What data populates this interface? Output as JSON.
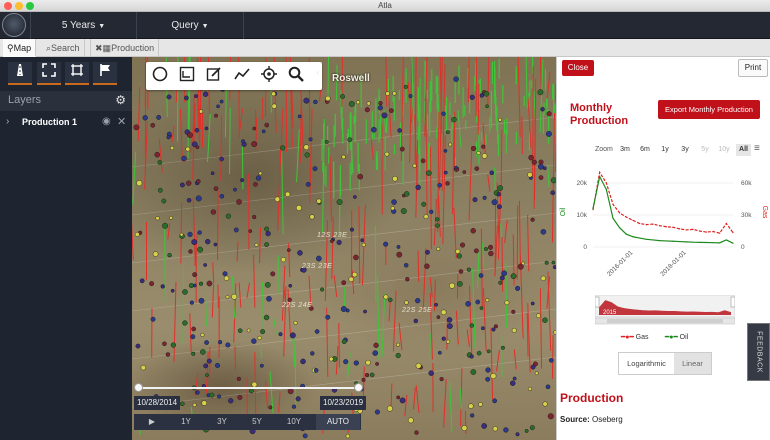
{
  "window": {
    "title": "Atla",
    "traffic_lights": [
      "#ff5f57",
      "#febc2e",
      "#28c840"
    ]
  },
  "header": {
    "years_dropdown": "5 Years",
    "query_dropdown": "Query"
  },
  "tabs": [
    {
      "label": "Map",
      "icon": "map-pin-icon"
    },
    {
      "label": "Search",
      "icon": "search-icon"
    },
    {
      "label": "Production",
      "icon": "close-icon"
    }
  ],
  "sidebar": {
    "tool_icons": [
      "road-icon",
      "fullscreen-icon",
      "selection-frame-icon",
      "flag-icon"
    ],
    "layers_title": "Layers",
    "layers": [
      {
        "name": "Production 1"
      }
    ]
  },
  "map": {
    "tools": [
      "circle-draw-icon",
      "rectangle-draw-icon",
      "edit-icon",
      "polyline-icon",
      "locate-icon",
      "search-icon"
    ],
    "city_label": "Roswell",
    "region_labels": [
      "12S 23E",
      "23S 23E",
      "22S 24E",
      "22S 25E"
    ],
    "accent_red": "#e0302a",
    "accent_green": "#3fc43a",
    "timeline": {
      "start_date": "10/28/2014",
      "end_date": "10/23/2019",
      "buttons": [
        "1Y",
        "3Y",
        "5Y",
        "10Y",
        "AUTO"
      ]
    }
  },
  "production_panel": {
    "close_label": "Close",
    "print_label": "Print",
    "title": "Monthly Production",
    "export_label": "Export Monthly Production",
    "zoom_label": "Zoom",
    "zoom_options": [
      "3m",
      "6m",
      "1y",
      "3y",
      "5y",
      "10y",
      "All"
    ],
    "zoom_selected": "All",
    "legend": [
      "Gas",
      "Oil"
    ],
    "scale_options": [
      "Logarithmic",
      "Linear"
    ],
    "scale_selected": "Linear",
    "section_title": "Production",
    "source_label": "Source:",
    "source_value": "Oseberg",
    "navigator_label": "2015"
  },
  "feedback_label": "FEEDBACK",
  "chart_data": {
    "type": "line",
    "title": "",
    "xlabel": "",
    "x_tick_labels": [
      "2016-01-01",
      "2018-01-01"
    ],
    "left_axis": {
      "label": "Oil",
      "ticks": [
        "0",
        "10k",
        "20k"
      ],
      "ylim": [
        0,
        25000
      ]
    },
    "right_axis": {
      "label": "Gas",
      "ticks": [
        "0",
        "30k",
        "60k"
      ],
      "ylim": [
        0,
        75000
      ]
    },
    "x": [
      "2015-01",
      "2015-03",
      "2015-05",
      "2015-07",
      "2015-09",
      "2015-11",
      "2016-01",
      "2016-04",
      "2016-07",
      "2016-10",
      "2017-01",
      "2017-04",
      "2017-07",
      "2017-10",
      "2018-01",
      "2018-04",
      "2018-07",
      "2018-10",
      "2019-01",
      "2019-04",
      "2019-07",
      "2019-10"
    ],
    "series": [
      {
        "name": "Gas",
        "axis": "right",
        "color": "#e02020",
        "dash": true,
        "values": [
          35000,
          70000,
          60000,
          40000,
          32000,
          28000,
          25000,
          22000,
          21000,
          21500,
          20000,
          19000,
          18500,
          17000,
          16000,
          16500,
          15000,
          14000,
          14500,
          13000,
          22000,
          13500
        ]
      },
      {
        "name": "Oil",
        "axis": "left",
        "color": "#1c8a1c",
        "dash": false,
        "values": [
          12000,
          22000,
          18000,
          9000,
          6000,
          4000,
          3200,
          2800,
          2400,
          2200,
          2000,
          1900,
          1800,
          1700,
          1600,
          1500,
          1450,
          1400,
          1350,
          1300,
          2200,
          1200
        ]
      }
    ],
    "legend_position": "bottom"
  }
}
